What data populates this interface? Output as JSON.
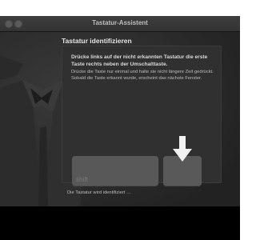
{
  "window": {
    "title": "Tastatur-Assistent"
  },
  "main": {
    "heading": "Tastatur identifizieren",
    "instruction_title": "Drücke links auf der nicht erkannten Tastatur die erste Taste rechts neben der Umschalttaste.",
    "instruction_body": "Drücke die Taste nur einmal und halte sie nicht längere Zeit gedrückt. Sobald die Taste erkannt wurde, erscheint das nächste Fenster."
  },
  "keyboard": {
    "shift_label": "shift"
  },
  "status": {
    "text": "Die Tastatur wird identifiziert …"
  }
}
